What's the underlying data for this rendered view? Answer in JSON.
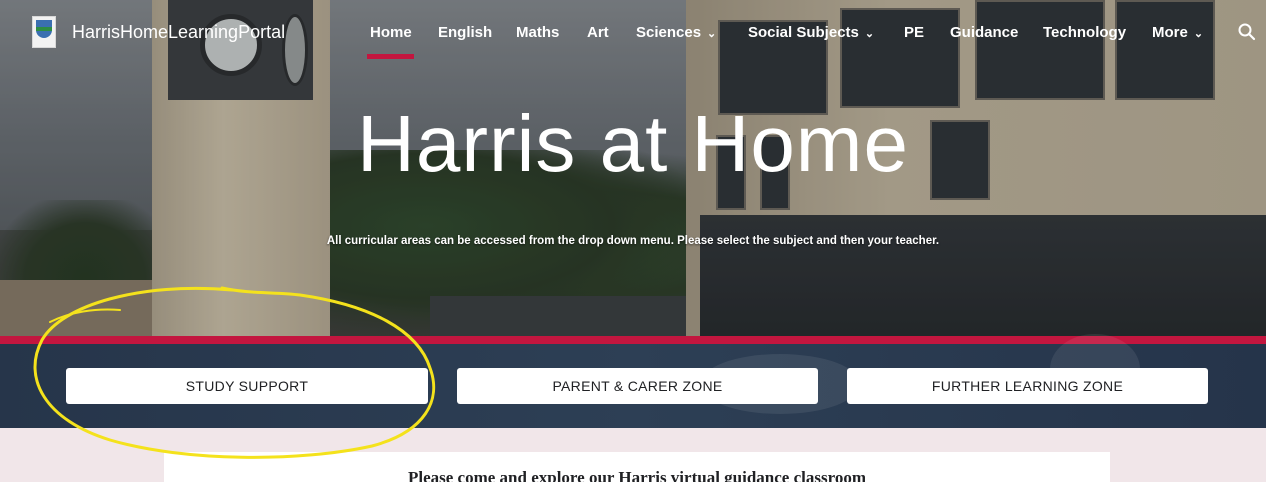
{
  "site": {
    "title": "HarrisHomeLearningPortal"
  },
  "nav": {
    "items": [
      {
        "label": "Home",
        "active": true
      },
      {
        "label": "English"
      },
      {
        "label": "Maths"
      },
      {
        "label": "Art"
      },
      {
        "label": "Sciences",
        "dropdown": true
      },
      {
        "label": "Social Subjects",
        "dropdown": true
      },
      {
        "label": "PE"
      },
      {
        "label": "Guidance"
      },
      {
        "label": "Technology"
      },
      {
        "label": "More",
        "dropdown": true
      }
    ],
    "search_icon": "search-icon",
    "chevron_glyph": "⌄"
  },
  "hero": {
    "title": "Harris at Home",
    "subtitle": "All curricular areas can be accessed from the drop down menu. Please select the subject and then your teacher."
  },
  "zones": [
    {
      "label": "STUDY SUPPORT"
    },
    {
      "label": "PARENT & CARER ZONE"
    },
    {
      "label": "FURTHER LEARNING ZONE"
    }
  ],
  "content": {
    "card_text": "Please come and explore our Harris virtual guidance classroom"
  },
  "colors": {
    "accent": "#c3163f",
    "banner": "#2b3b50",
    "content_bg": "#f1e6e9",
    "annotation": "#f4e21c"
  }
}
